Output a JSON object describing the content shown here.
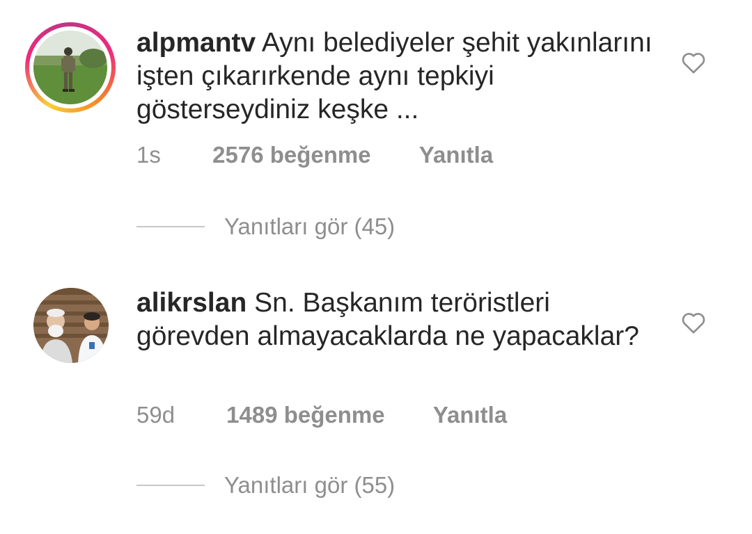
{
  "comments": [
    {
      "username": "alpmantv",
      "text": "Aynı belediyeler şehit yakınlarını işten çıkarırkende aynı tepkiyi gösterseydiniz keşke ...",
      "time": "1s",
      "likes": "2576 beğenme",
      "reply_label": "Yanıtla",
      "view_replies": "Yanıtları gör (45)",
      "avatar_icon": "soldier-photo-avatar",
      "has_story_ring": true
    },
    {
      "username": "alikrslan",
      "text": "Sn. Başkanım teröristleri görevden almayacaklarda ne yapacaklar?",
      "time": "59d",
      "likes": "1489 beğenme",
      "reply_label": "Yanıtla",
      "view_replies": "Yanıtları gör (55)",
      "avatar_icon": "two-people-photo-avatar",
      "has_story_ring": false
    }
  ],
  "colors": {
    "text_primary": "#262626",
    "text_secondary": "#8e8e8e",
    "divider": "#c7c7c7",
    "story_ring": [
      "#f9ce34",
      "#ee2a7b",
      "#c13584"
    ]
  },
  "icons": {
    "like": "heart-outline-icon"
  }
}
